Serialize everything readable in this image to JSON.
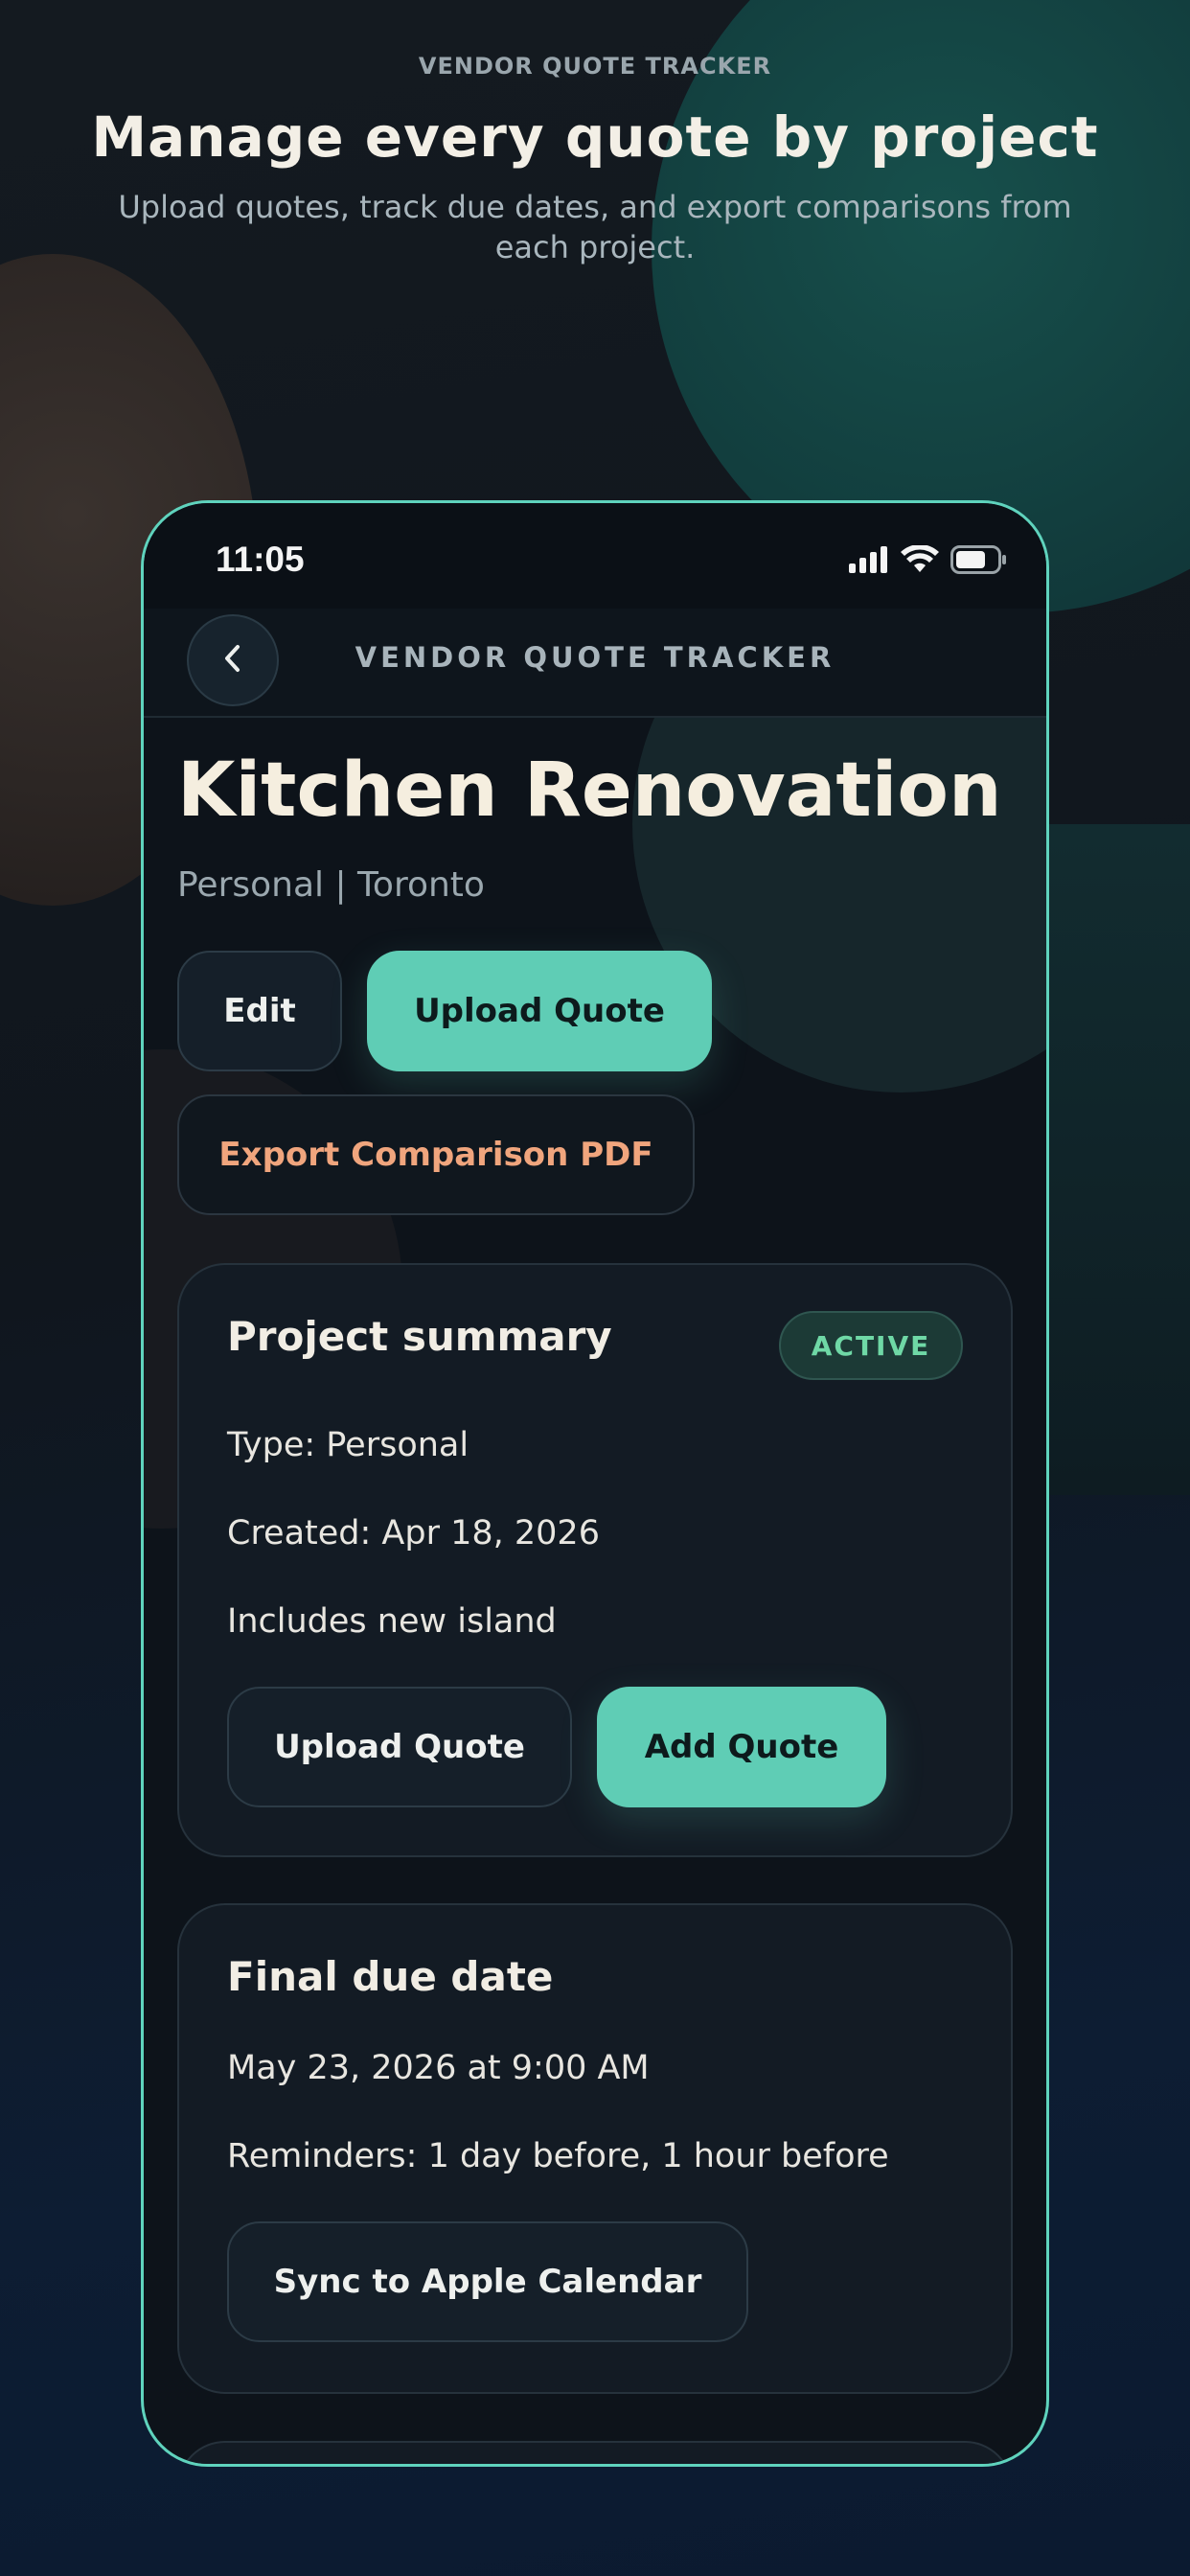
{
  "marketing": {
    "eyebrow": "VENDOR QUOTE TRACKER",
    "headline": "Manage every quote by project",
    "subhead": "Upload quotes, track due dates, and export comparisons from each project."
  },
  "status_bar": {
    "time": "11:05",
    "icons": [
      "cellular-signal-icon",
      "wifi-icon",
      "battery-icon"
    ]
  },
  "nav": {
    "back_icon": "chevron-left-icon",
    "title": "VENDOR QUOTE TRACKER"
  },
  "project": {
    "title": "Kitchen Renovation",
    "subtitle": "Personal | Toronto",
    "actions": {
      "edit": "Edit",
      "upload_quote": "Upload Quote",
      "export_pdf": "Export Comparison PDF"
    }
  },
  "summary_card": {
    "title": "Project summary",
    "status_badge": "ACTIVE",
    "type": "Type: Personal",
    "created": "Created: Apr 18, 2026",
    "note": "Includes new island",
    "upload_quote": "Upload Quote",
    "add_quote": "Add Quote"
  },
  "due_card": {
    "title": "Final due date",
    "date": "May 23, 2026 at 9:00 AM",
    "reminders": "Reminders: 1 day before, 1 hour before",
    "sync_button": "Sync to Apple Calendar"
  },
  "colors": {
    "accent_teal": "#5fcdb5",
    "accent_orange": "#f0a57d",
    "badge_green": "#6fd8a6",
    "phone_border": "#5fd3bd"
  }
}
